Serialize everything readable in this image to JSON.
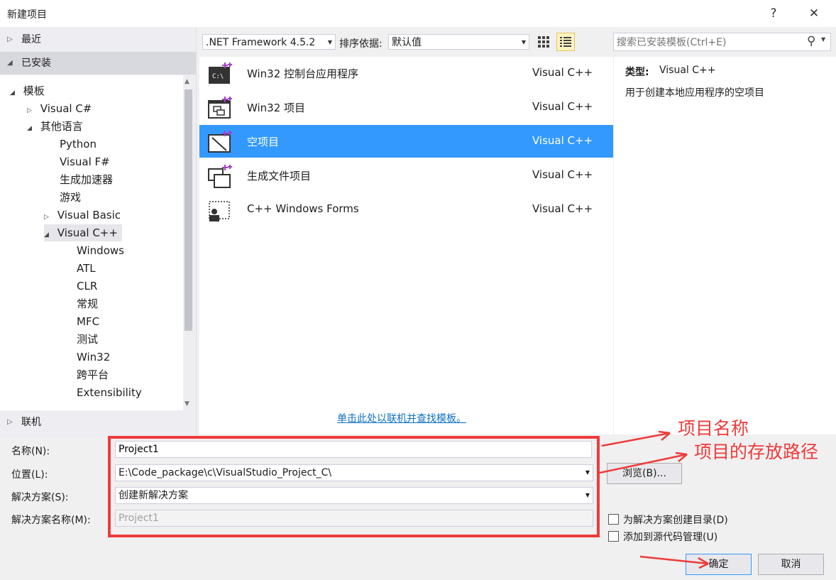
{
  "window": {
    "title": "新建项目",
    "help": "?",
    "close": "✕"
  },
  "sidebar": {
    "recent": "最近",
    "installed": "已安装",
    "online": "联机",
    "tree": [
      {
        "label": "模板",
        "toggle": "◢"
      },
      {
        "label": "Visual C#",
        "toggle": "▷"
      },
      {
        "label": "其他语言",
        "toggle": "◢"
      },
      {
        "label": "Python",
        "toggle": ""
      },
      {
        "label": "Visual F#",
        "toggle": ""
      },
      {
        "label": "生成加速器",
        "toggle": ""
      },
      {
        "label": "游戏",
        "toggle": ""
      },
      {
        "label": "Visual Basic",
        "toggle": "▷"
      },
      {
        "label": "Visual C++",
        "toggle": "◢"
      },
      {
        "label": "Windows",
        "toggle": ""
      },
      {
        "label": "ATL",
        "toggle": ""
      },
      {
        "label": "CLR",
        "toggle": ""
      },
      {
        "label": "常规",
        "toggle": ""
      },
      {
        "label": "MFC",
        "toggle": ""
      },
      {
        "label": "测试",
        "toggle": ""
      },
      {
        "label": "Win32",
        "toggle": ""
      },
      {
        "label": "跨平台",
        "toggle": ""
      },
      {
        "label": "Extensibility",
        "toggle": ""
      }
    ]
  },
  "toolbar": {
    "framework": ".NET Framework 4.5.2",
    "sort_label": "排序依据:",
    "sort_value": "默认值",
    "search_placeholder": "搜索已安装模板(Ctrl+E)"
  },
  "templates": [
    {
      "name": "Win32 控制台应用程序",
      "lang": "Visual C++",
      "icon": "console-app-icon"
    },
    {
      "name": "Win32 项目",
      "lang": "Visual C++",
      "icon": "win32-project-icon"
    },
    {
      "name": "空项目",
      "lang": "Visual C++",
      "icon": "empty-project-icon"
    },
    {
      "name": "生成文件项目",
      "lang": "Visual C++",
      "icon": "makefile-project-icon"
    },
    {
      "name": "C++ Windows Forms",
      "lang": "Visual C++",
      "icon": "windows-forms-icon"
    }
  ],
  "online_link": "单击此处以联机并查找模板。",
  "details": {
    "type_label": "类型:",
    "type_value": "Visual C++",
    "description": "用于创建本地应用程序的空项目"
  },
  "form": {
    "name_label": "名称(N):",
    "name_value": "Project1",
    "location_label": "位置(L):",
    "location_value": "E:\\Code_package\\c\\VisualStudio_Project_C\\",
    "solution_label": "解决方案(S):",
    "solution_value": "创建新解决方案",
    "solution_name_label": "解决方案名称(M):",
    "solution_name_value": "Project1",
    "browse": "浏览(B)...",
    "create_dir": "为解决方案创建目录(D)",
    "add_scc": "添加到源代码管理(U)",
    "ok": "确定",
    "cancel": "取消"
  },
  "annotations": {
    "name": "项目名称",
    "path": "项目的存放路径"
  },
  "colors": {
    "selection": "#3399ff",
    "annotation": "#ee3b3b",
    "link": "#0e70c0"
  }
}
